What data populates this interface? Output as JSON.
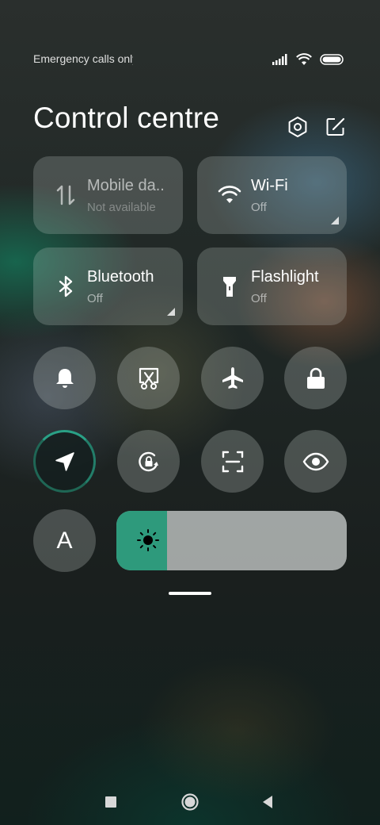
{
  "status": {
    "carrier_text": "Emergency calls only",
    "icons": [
      "signal-icon",
      "wifi-icon",
      "battery-icon"
    ]
  },
  "header": {
    "title": "Control centre",
    "icons": [
      "settings-icon",
      "edit-icon"
    ]
  },
  "tiles": [
    {
      "name": "Mobile da..",
      "sub": "Not available",
      "icon": "mobile-data-icon",
      "active": false
    },
    {
      "name": "Wi-Fi",
      "sub": "Off",
      "icon": "wifi-icon",
      "active": false
    },
    {
      "name": "Bluetooth",
      "sub": "Off",
      "icon": "bluetooth-icon",
      "active": false
    },
    {
      "name": "Flashlight",
      "sub": "Off",
      "icon": "flashlight-icon",
      "active": false
    }
  ],
  "toggles": [
    {
      "icon": "bell-icon",
      "active": false
    },
    {
      "icon": "screenshot-icon",
      "active": false
    },
    {
      "icon": "airplane-icon",
      "active": false
    },
    {
      "icon": "lock-icon",
      "active": false
    },
    {
      "icon": "location-icon",
      "active": true
    },
    {
      "icon": "rotation-lock-icon",
      "active": false
    },
    {
      "icon": "scanner-icon",
      "active": false
    },
    {
      "icon": "eye-icon",
      "active": false
    }
  ],
  "font_button": {
    "label": "A"
  },
  "brightness": {
    "level": 0.22,
    "icon": "brightness-icon"
  },
  "nav": [
    "recents-icon",
    "home-icon",
    "back-icon"
  ],
  "colors": {
    "accent": "#2e9a7c"
  }
}
